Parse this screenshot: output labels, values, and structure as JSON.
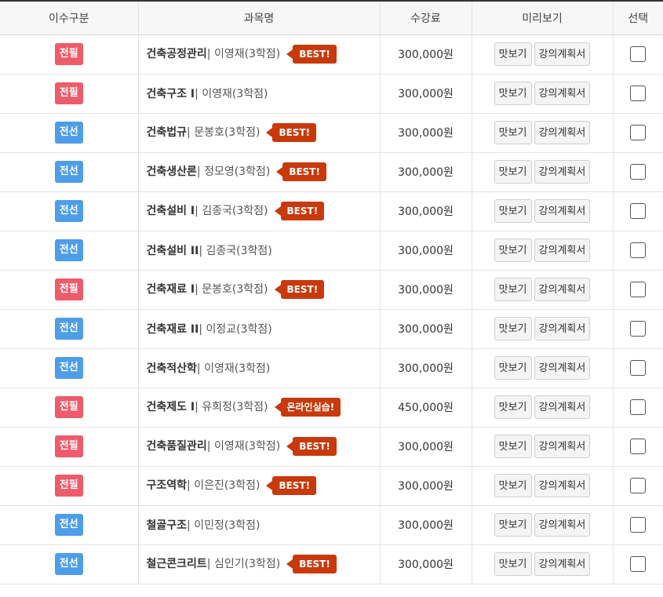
{
  "header": {
    "col_type": "이수구분",
    "col_name": "과목명",
    "col_fee": "수강료",
    "col_preview": "미리보기",
    "col_select": "선택"
  },
  "buttons": {
    "sample": "맛보기",
    "plan": "강의계획서"
  },
  "colors": {
    "required_badge": "#ee5b6a",
    "elective_badge": "#4e9de8",
    "tag": "#c8390b"
  },
  "rows": [
    {
      "type": "전필",
      "kind": "required",
      "name": "건축공정관리",
      "prof": "| 이영재(3학점)",
      "tag": "BEST!",
      "fee": "300,000원"
    },
    {
      "type": "전필",
      "kind": "required",
      "name": "건축구조 I",
      "prof": "| 이영재(3학점)",
      "tag": "",
      "fee": "300,000원"
    },
    {
      "type": "전선",
      "kind": "elective",
      "name": "건축법규",
      "prof": "| 문봉호(3학점)",
      "tag": "BEST!",
      "fee": "300,000원"
    },
    {
      "type": "전선",
      "kind": "elective",
      "name": "건축생산론",
      "prof": "| 정모영(3학점)",
      "tag": "BEST!",
      "fee": "300,000원"
    },
    {
      "type": "전선",
      "kind": "elective",
      "name": "건축설비 I",
      "prof": "| 김종국(3학점)",
      "tag": "BEST!",
      "fee": "300,000원"
    },
    {
      "type": "전선",
      "kind": "elective",
      "name": "건축설비 II",
      "prof": "| 김종국(3학점)",
      "tag": "",
      "fee": "300,000원"
    },
    {
      "type": "전필",
      "kind": "required",
      "name": "건축재료 I",
      "prof": "| 문봉호(3학점)",
      "tag": "BEST!",
      "fee": "300,000원"
    },
    {
      "type": "전선",
      "kind": "elective",
      "name": "건축재료 II",
      "prof": "| 이정교(3학점)",
      "tag": "",
      "fee": "300,000원"
    },
    {
      "type": "전선",
      "kind": "elective",
      "name": "건축적산학",
      "prof": "| 이영재(3학점)",
      "tag": "",
      "fee": "300,000원"
    },
    {
      "type": "전필",
      "kind": "required",
      "name": "건축제도 I",
      "prof": "| 유희정(3학점)",
      "tag": "온라인실습!",
      "fee": "450,000원"
    },
    {
      "type": "전필",
      "kind": "required",
      "name": "건축품질관리",
      "prof": "| 이영재(3학점)",
      "tag": "BEST!",
      "fee": "300,000원"
    },
    {
      "type": "전필",
      "kind": "required",
      "name": "구조역학",
      "prof": "| 이은진(3학점)",
      "tag": "BEST!",
      "fee": "300,000원"
    },
    {
      "type": "전선",
      "kind": "elective",
      "name": "철골구조",
      "prof": "| 이민정(3학점)",
      "tag": "",
      "fee": "300,000원"
    },
    {
      "type": "전선",
      "kind": "elective",
      "name": "철근콘크리트",
      "prof": "| 심인기(3학점)",
      "tag": "BEST!",
      "fee": "300,000원"
    }
  ]
}
